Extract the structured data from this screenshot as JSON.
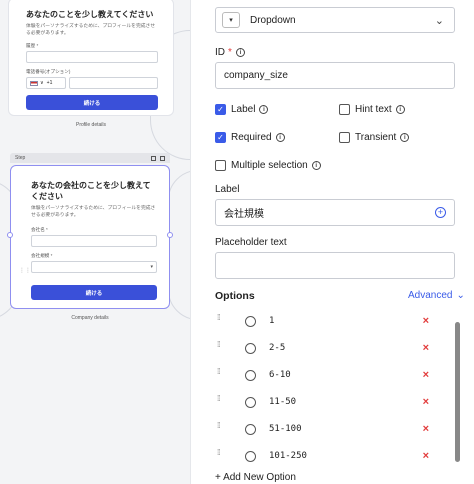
{
  "canvas": {
    "card1": {
      "title": "あなたのことを少し教えてください",
      "subtitle": "体験をパーソナライズするために、プロフィールを完成させる必要があります。",
      "field1_label": "履歴 *",
      "field2_label": "電話番号(オプション)",
      "phone_code": "+1",
      "button": "続ける",
      "caption": "Profile details"
    },
    "card2": {
      "header_label": "Step",
      "title": "あなたの会社のことを少し教えてください",
      "subtitle": "体験をパーソナライズするために、プロフィールを完成させる必要があります。",
      "field1_label": "会社名 *",
      "field2_label": "会社規模 *",
      "button": "続ける",
      "caption": "Company details"
    }
  },
  "panel": {
    "dropdown_type": "Dropdown",
    "id_label": "ID",
    "id_required_mark": "*",
    "id_value": "company_size",
    "checks": {
      "label": "Label",
      "hint_text": "Hint text",
      "required": "Required",
      "transient": "Transient",
      "multiple": "Multiple selection"
    },
    "label_section": "Label",
    "label_value": "会社規模",
    "placeholder_section": "Placeholder text",
    "placeholder_value": "",
    "options_title": "Options",
    "advanced": "Advanced",
    "options": [
      "1",
      "2-5",
      "6-10",
      "11-50",
      "51-100",
      "101-250"
    ],
    "add_option": "+ Add New Option"
  },
  "colors": {
    "accent": "#3a5be8",
    "delete": "#e23b3b",
    "button": "#3a50d9"
  }
}
